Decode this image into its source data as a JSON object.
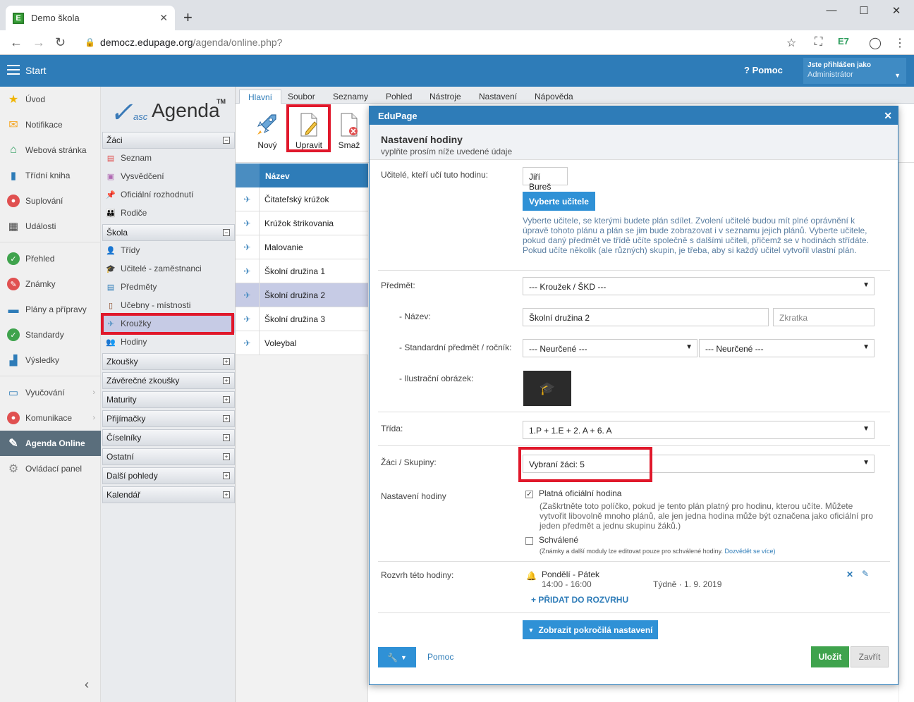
{
  "browser": {
    "tab_title": "Demo škola",
    "url_host": "democz.edupage.org",
    "url_path": "/agenda/online.php?"
  },
  "header": {
    "start": "Start",
    "help": "Pomoc",
    "logged_in_as": "Jste přihlášen jako",
    "role": "Administrátor"
  },
  "leftmenu": [
    {
      "label": "Úvod",
      "icon": "star-icon",
      "color": "#f0b400"
    },
    {
      "label": "Notifikace",
      "icon": "envelope-icon",
      "color": "#f5a623"
    },
    {
      "label": "Webová stránka",
      "icon": "home-icon",
      "color": "#2e9e5e"
    },
    {
      "label": "Třídní kniha",
      "icon": "book-icon",
      "color": "#2e7cb8"
    },
    {
      "label": "Suplování",
      "icon": "user-icon",
      "color": "#e05050"
    },
    {
      "label": "Události",
      "icon": "calendar-icon",
      "color": "#444444"
    },
    {
      "label": "Přehled",
      "icon": "check-icon",
      "color": "#3fa34d"
    },
    {
      "label": "Známky",
      "icon": "grade-icon",
      "color": "#e05050"
    },
    {
      "label": "Plány a přípravy",
      "icon": "briefcase-icon",
      "color": "#2e7cb8"
    },
    {
      "label": "Standardy",
      "icon": "shield-icon",
      "color": "#3fa34d"
    },
    {
      "label": "Výsledky",
      "icon": "barchart-icon",
      "color": "#2e7cb8"
    },
    {
      "label": "Vyučování",
      "icon": "book-open-icon",
      "color": "#2e7cb8"
    },
    {
      "label": "Komunikace",
      "icon": "chat-icon",
      "color": "#e05050"
    },
    {
      "label": "Agenda Online",
      "icon": "pencil-icon",
      "color": "#ffffff"
    },
    {
      "label": "Ovládací panel",
      "icon": "gear-icon",
      "color": "#888888"
    }
  ],
  "agenda": {
    "logo_asc": "asc",
    "logo_agenda": "Agenda",
    "logo_tm": "TM",
    "sections": {
      "zaci": "Žáci",
      "skola": "Škola",
      "zkousky": "Zkoušky",
      "zaverecne": "Závěrečné zkoušky",
      "maturity": "Maturity",
      "prijimacky": "Přijímačky",
      "ciselniky": "Číselníky",
      "ostatni": "Ostatní",
      "dalsi": "Další pohledy",
      "kalendar": "Kalendář"
    },
    "zaci_items": [
      "Seznam",
      "Vysvědčení",
      "Oficiální rozhodnutí",
      "Rodiče"
    ],
    "skola_items": [
      "Třídy",
      "Učitelé - zaměstnanci",
      "Předměty",
      "Učebny - místnosti",
      "Kroužky",
      "Hodiny"
    ]
  },
  "toolbar": {
    "tabs": [
      "Hlavní",
      "Soubor",
      "Seznamy",
      "Pohled",
      "Nástroje",
      "Nastavení",
      "Nápověda"
    ],
    "new": "Nový",
    "edit": "Upravit",
    "delete": "Smaž"
  },
  "list": {
    "header": "Název",
    "rows": [
      "Čitateľský krúžok",
      "Krúžok štrikovania",
      "Malovanie",
      "Školní družina 1",
      "Školní družina 2",
      "Školní družina 3",
      "Voleybal"
    ]
  },
  "dialog": {
    "title": "EduPage",
    "heading": "Nastavení hodiny",
    "subheading": "vyplňte prosím níže uvedené údaje",
    "teachers_label": "Učitelé, kteří učí tuto hodinu:",
    "teacher_name": "Jiří Bureš",
    "choose_teacher": "Vyberte učitele",
    "teacher_hint": "Vyberte učitele, se kterými budete plán sdílet. Zvolení učitelé budou mít plné oprávnění k úpravě tohoto plánu a plán se jim bude zobrazovat i v seznamu jejich plánů. Vyberte učitele, pokud daný předmět ve třídě učíte společně s dalšími učiteli, přičemž se v hodinách střídáte. Pokud učíte několik (ale různých) skupin, je třeba, aby si každý učitel vytvořil vlastní plán.",
    "subject_label": "Předmět:",
    "subject_value": "--- Kroužek / ŠKD ---",
    "name_label": "- Název:",
    "name_value": "Školní družina 2",
    "abbr_placeholder": "Zkratka",
    "std_label": "- Standardní předmět / ročník:",
    "std_subject": "--- Neurčené ---",
    "std_grade": "--- Neurčené ---",
    "image_label": "- Ilustrační obrázek:",
    "class_label": "Třída:",
    "class_value": "1.P + 1.E + 2. A + 6. A",
    "students_label": "Žáci / Skupiny:",
    "students_value": "Vybraní žáci: 5",
    "lesson_label": "Nastavení hodiny",
    "official_label": "Platná oficiální hodina",
    "official_hint": "(Zaškrtněte toto políčko, pokud je tento plán platný pro hodinu, kterou učíte. Můžete vytvořit libovolně mnoho plánů, ale jen jedna hodina může být označena jako oficiální pro jeden předmět a jednu skupinu žáků.)",
    "approved_label": "Schválené",
    "approved_hint": "(Známky a další moduly lze editovat pouze pro schválené hodiny.",
    "approved_link": "Dozvědět se více)",
    "schedule_label": "Rozvrh této hodiny:",
    "schedule_days": "Pondělí - Pátek",
    "schedule_time": "14:00 - 16:00",
    "schedule_freq": "Týdně · 1. 9. 2019",
    "add_schedule": "+ PŘIDAT DO ROZVRHU",
    "advanced": "Zobrazit pokročilá nastavení",
    "help": "Pomoc",
    "save": "Uložit",
    "close": "Zavřít"
  }
}
